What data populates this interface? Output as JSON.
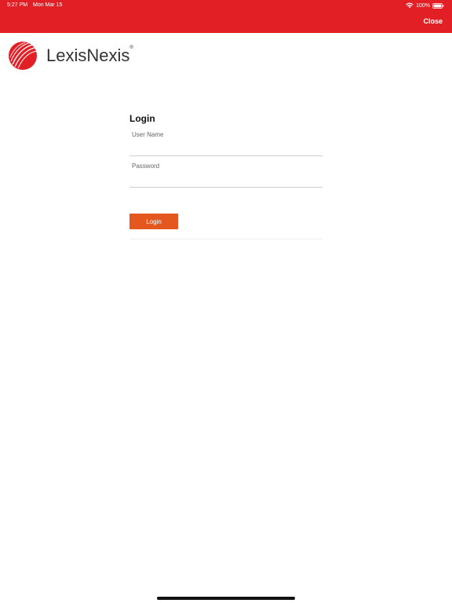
{
  "status_bar": {
    "time": "5:27 PM",
    "date": "Mon Mar 15",
    "battery": "100%",
    "wifi_icon": "wifi-icon",
    "battery_icon": "battery-icon"
  },
  "header": {
    "close_label": "Close",
    "background_color": "#e31f26"
  },
  "logo": {
    "text": "LexisNexis",
    "registered": "®",
    "mark_icon": "lexisnexis-globe-icon",
    "mark_color": "#e31f26"
  },
  "login": {
    "title": "Login",
    "username_label": "User Name",
    "username_value": "",
    "password_label": "Password",
    "password_value": "",
    "button_label": "Login",
    "button_color": "#e4571f"
  }
}
